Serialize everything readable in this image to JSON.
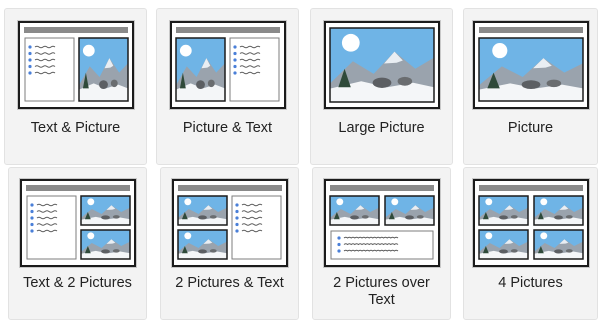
{
  "layout_picker": {
    "layouts": [
      {
        "label": "Text & Picture"
      },
      {
        "label": "Picture & Text"
      },
      {
        "label": "Large Picture"
      },
      {
        "label": "Picture"
      },
      {
        "label": "Text & 2 Pictures"
      },
      {
        "label": "2 Pictures & Text"
      },
      {
        "label": "2 Pictures over\nText"
      },
      {
        "label": "4 Pictures"
      }
    ]
  },
  "colors": {
    "tile_bg": "#f3f3f3",
    "title_bar": "#8a8a8a",
    "bullet": "#4a7fd8",
    "sky": "#6fb4e6",
    "mountain": "#9aa3ad",
    "snow": "#f4f6f8"
  }
}
